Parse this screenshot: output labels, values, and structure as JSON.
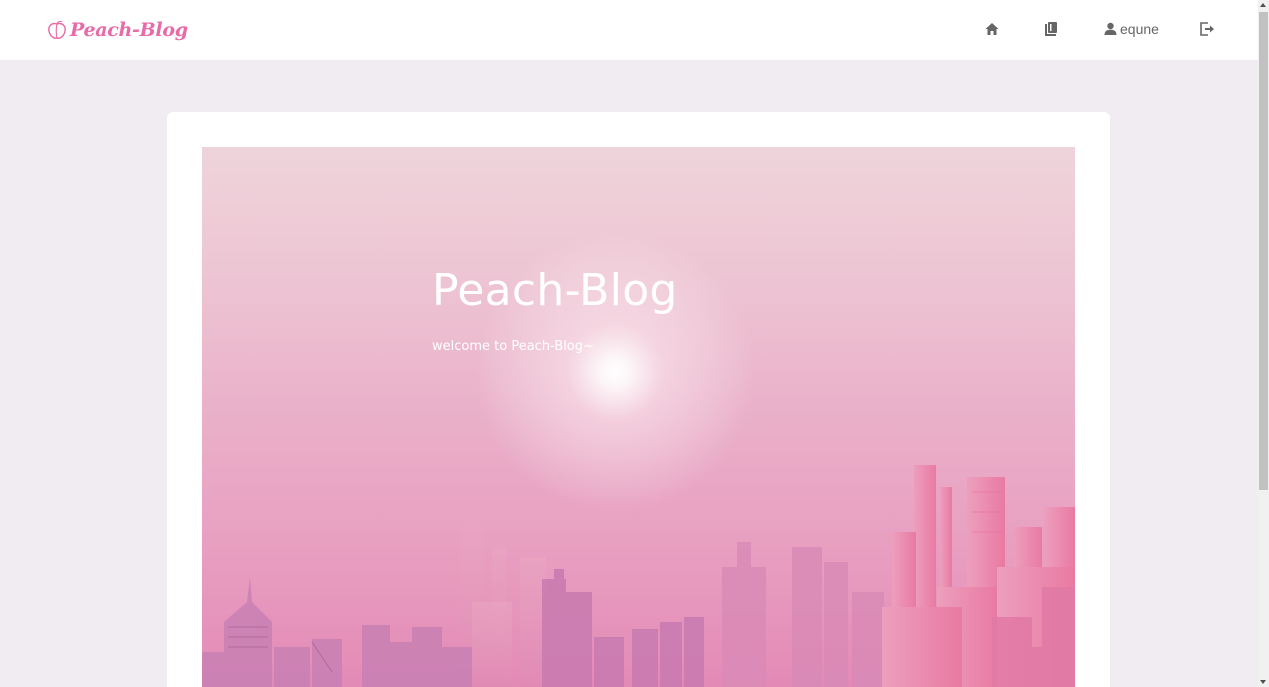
{
  "header": {
    "logo_text": "Peach-Blog",
    "nav": [
      {
        "name": "home",
        "icon": "home-icon"
      },
      {
        "name": "books",
        "icon": "books-icon"
      },
      {
        "name": "user",
        "icon": "user-icon",
        "label": "equne"
      },
      {
        "name": "logout",
        "icon": "logout-icon"
      }
    ]
  },
  "hero": {
    "title": "Peach-Blog",
    "subtitle": "welcome to Peach-Blog~"
  },
  "colors": {
    "brand": "#e86aa6",
    "page_background": "#f1ecf2",
    "nav_icon": "#666666"
  }
}
